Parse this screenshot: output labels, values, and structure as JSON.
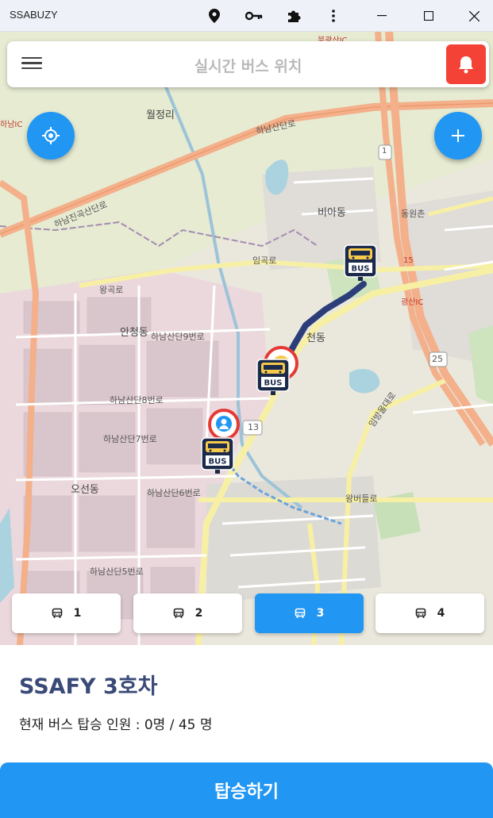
{
  "window": {
    "title": "SSABUZY",
    "icons": [
      "location-pin-icon",
      "key-icon",
      "puzzle-extension-icon",
      "more-vert-icon",
      "minimize-icon",
      "maximize-icon",
      "close-icon"
    ]
  },
  "header": {
    "title": "실시간 버스 위치",
    "menu_icon": "hamburger-menu-icon",
    "alarm_icon": "bell-icon"
  },
  "map": {
    "labels": {
      "wolgeongri": "월정리",
      "biadong": "비아동",
      "dongwonchon": "동원촌",
      "anchungdong": "안청동",
      "oseondong": "오선동",
      "cheondong": "천동",
      "hanam_jingok": "하남진곡산단로",
      "hanam_sandan_lo": "하남산단로",
      "imgoklo": "임곡로",
      "wanggoklo": "왕곡로",
      "hanam_9": "하남산단9번로",
      "hanam_8": "하남산단8번로",
      "hanam_7": "하남산단7번로",
      "hanam_6": "하남산단6번로",
      "hanam_5": "하남산단5번로",
      "imbang_ul": "임방울대로",
      "wangbeodeul": "왕버들로",
      "gwangsan_ic": "광산IC",
      "road_1": "1",
      "road_13": "13",
      "road_25": "25",
      "road_15": "15",
      "bukgwangsan_ic": "북광산IC",
      "hanam_ic": "하남IC"
    },
    "bus_marker_text": "BUS"
  },
  "bus_tabs": [
    {
      "label": "1",
      "active": false
    },
    {
      "label": "2",
      "active": false
    },
    {
      "label": "3",
      "active": true
    },
    {
      "label": "4",
      "active": false
    }
  ],
  "info": {
    "bus_name": "SSAFY 3호차",
    "passenger_text": "현재 버스 탑승 인원 : 0명 / 45 명"
  },
  "board_button": "탑승하기",
  "colors": {
    "primary": "#2196f3",
    "alarm": "#f44336",
    "route": "#2c3e7a",
    "bus_name": "#3a4a78"
  }
}
